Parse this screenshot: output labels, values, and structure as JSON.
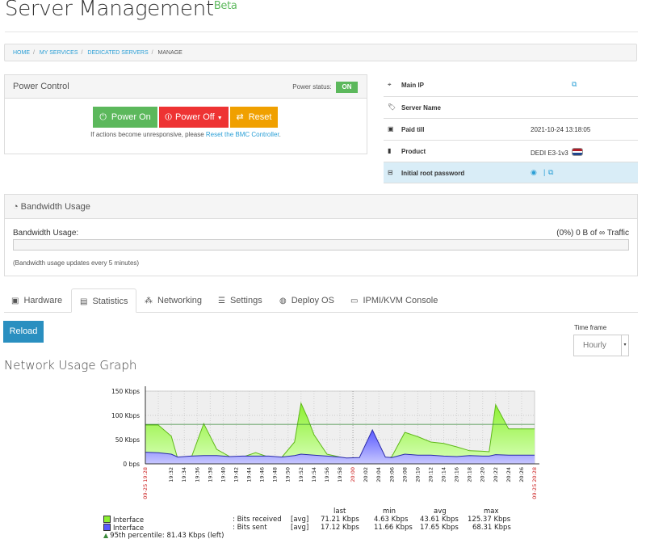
{
  "page": {
    "title": "Server Management",
    "title_badge": "Beta"
  },
  "breadcrumb": {
    "home": "HOME",
    "services": "MY SERVICES",
    "dedicated": "DEDICATED SERVERS",
    "current": "MANAGE"
  },
  "power": {
    "heading": "Power Control",
    "status_label": "Power status:",
    "status_value": "ON",
    "btn_on": "Power On",
    "btn_off": "Power Off",
    "btn_reset": "Reset",
    "note_prefix": "If actions become unresponsive, please ",
    "note_link": "Reset the BMC Controller",
    "note_suffix": "."
  },
  "server_info": {
    "main_ip_label": "Main IP",
    "server_name_label": "Server Name",
    "paid_till_label": "Paid till",
    "paid_till_value": "2021-10-24 13:18:05",
    "product_label": "Product",
    "product_value": "DEDI E3-1v3",
    "root_password_label": "Initial root password"
  },
  "bandwidth": {
    "heading": "Bandwidth Usage",
    "label": "Bandwidth Usage:",
    "summary": "(0%) 0 B of ∞ Traffic",
    "progress_fraction": 0,
    "note": "(Bandwidth usage updates every 5 minutes)"
  },
  "tabs": [
    {
      "label": "Hardware",
      "icon": "chip-icon"
    },
    {
      "label": "Statistics",
      "icon": "chart-icon",
      "active": true
    },
    {
      "label": "Networking",
      "icon": "network-icon"
    },
    {
      "label": "Settings",
      "icon": "sliders-icon"
    },
    {
      "label": "Deploy OS",
      "icon": "globe-icon"
    },
    {
      "label": "IPMI/KVM Console",
      "icon": "console-icon"
    }
  ],
  "controls": {
    "reload": "Reload",
    "timeframe_label": "Time frame",
    "timeframe_value": "Hourly"
  },
  "graph": {
    "heading": "Network Usage Graph"
  },
  "chart_data": {
    "type": "area",
    "y_ticks": [
      "0 bps",
      "50 Kbps",
      "100 Kbps",
      "150 Kbps"
    ],
    "ylim": [
      0,
      150
    ],
    "x_start_label": "09-25 19:28",
    "x_end_label": "09-25 20:28",
    "x_tick_labels": [
      "19:32",
      "19:34",
      "19:36",
      "19:38",
      "19:40",
      "19:42",
      "19:44",
      "19:46",
      "19:48",
      "19:50",
      "19:52",
      "19:54",
      "19:56",
      "19:58",
      "20:00",
      "20:02",
      "20:04",
      "20:06",
      "20:08",
      "20:10",
      "20:12",
      "20:14",
      "20:16",
      "20:18",
      "20:20",
      "20:22",
      "20:24",
      "20:26"
    ],
    "x_minutes": [
      0,
      4,
      8,
      10,
      14,
      18,
      22,
      26,
      30,
      34,
      38,
      42,
      46,
      48,
      50,
      52,
      56,
      60,
      62,
      66,
      70,
      74,
      76,
      80,
      84,
      88,
      92,
      96,
      100,
      104,
      106,
      108,
      112,
      114,
      116,
      120
    ],
    "series": [
      {
        "name": "Interface",
        "color": "#8cf031",
        "values": [
          80,
          80,
          57,
          10,
          10,
          83,
          30,
          15,
          14,
          23,
          14,
          13,
          45,
          125,
          95,
          60,
          20,
          14,
          10,
          8,
          6,
          8,
          15,
          65,
          56,
          45,
          42,
          35,
          27,
          26,
          25,
          122,
          72,
          72,
          72,
          72
        ]
      },
      {
        "name": "Interface",
        "color": "#5858ff",
        "values": [
          24,
          23,
          20,
          14,
          16,
          17,
          17,
          15,
          16,
          16,
          16,
          14,
          17,
          20,
          19,
          18,
          16,
          14,
          12,
          13,
          70,
          14,
          13,
          20,
          18,
          18,
          16,
          15,
          17,
          16,
          16,
          19,
          18,
          18,
          18,
          18
        ]
      }
    ],
    "percentile_line": 81.43,
    "legend": {
      "col_headers": [
        "last",
        "min",
        "avg",
        "max"
      ],
      "rows": [
        {
          "name": "Interface",
          "desc": ": Bits received",
          "agg": "[avg]",
          "last": "71.21 Kbps",
          "min": "4.63 Kbps",
          "avg": "43.61 Kbps",
          "max": "125.37 Kbps"
        },
        {
          "name": "Interface",
          "desc": ": Bits sent",
          "agg": "[avg]",
          "last": "17.12 Kbps",
          "min": "11.66 Kbps",
          "avg": "17.65 Kbps",
          "max": "68.31 Kbps"
        }
      ],
      "percentile_text": "95th percentile: 81.43 Kbps (left)"
    }
  },
  "colors": {
    "success": "#5cb85c",
    "danger": "#ee3333",
    "warning": "#f0a000",
    "primary": "#2a8fc0",
    "highlight_row": "#d9edf7"
  }
}
